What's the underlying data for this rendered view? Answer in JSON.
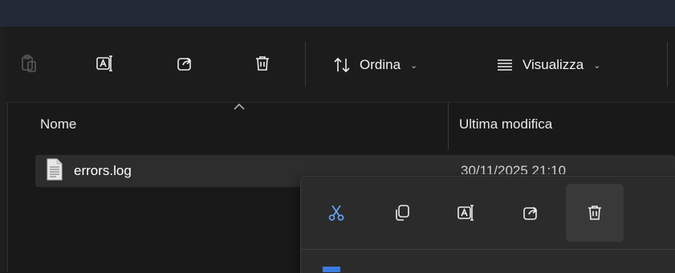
{
  "toolbar": {
    "paste_icon": "paste-icon",
    "rename_icon": "rename-icon",
    "share_icon": "share-icon",
    "delete_icon": "delete-icon",
    "sort_label": "Ordina",
    "view_label": "Visualizza"
  },
  "columns": {
    "name": "Nome",
    "modified": "Ultima modifica"
  },
  "files": [
    {
      "name": "errors.log",
      "modified": "30/11/2025 21:10",
      "icon": "text-file-icon"
    }
  ],
  "context_menu": {
    "icons": [
      "cut-icon",
      "copy-icon",
      "rename-icon",
      "share-icon",
      "delete-icon"
    ]
  }
}
